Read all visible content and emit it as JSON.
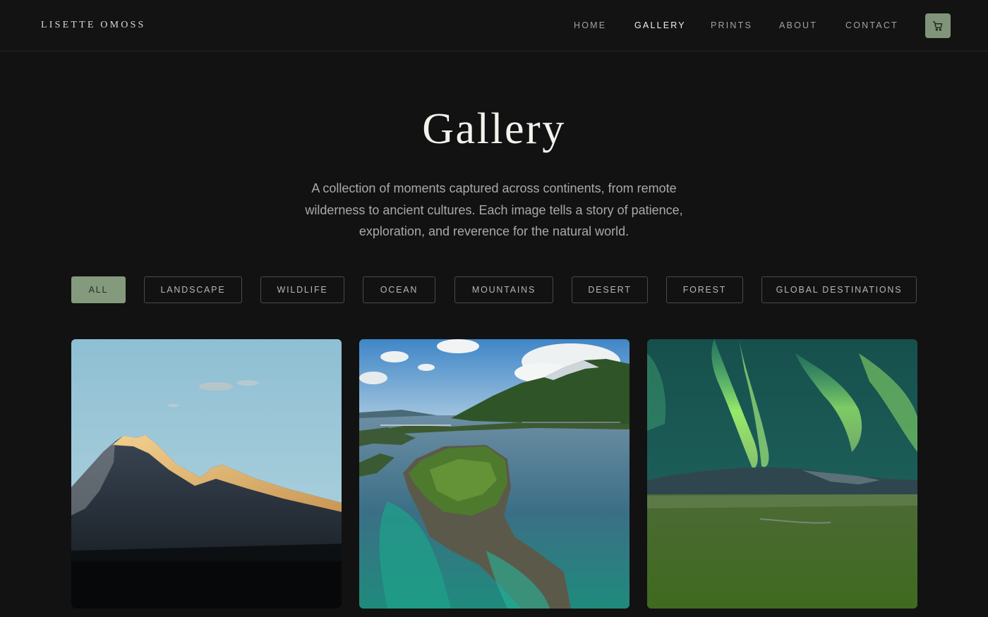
{
  "brand": "LISETTE OMOSS",
  "nav": {
    "items": [
      "HOME",
      "GALLERY",
      "PRINTS",
      "ABOUT",
      "CONTACT"
    ],
    "active": "GALLERY"
  },
  "page": {
    "title": "Gallery",
    "intro_lines": [
      "A collection of moments captured across continents, from remote",
      "wilderness to ancient cultures. Each image tells a story of patience,",
      "exploration, and reverence for the natural world."
    ]
  },
  "filters": {
    "items": [
      "ALL",
      "LANDSCAPE",
      "WILDLIFE",
      "OCEAN",
      "MOUNTAINS",
      "DESERT",
      "FOREST",
      "GLOBAL DESTINATIONS"
    ],
    "active": "ALL"
  },
  "gallery": [
    {
      "subject": "sunlit mountain peak at dusk"
    },
    {
      "subject": "aerial view of fjord islet with bridge"
    },
    {
      "subject": "northern lights over green plain"
    }
  ],
  "colors": {
    "background": "#121212",
    "accent": "#849a7c",
    "cart_button": "#7f9478"
  },
  "icons": {
    "cart": "cart-icon"
  }
}
